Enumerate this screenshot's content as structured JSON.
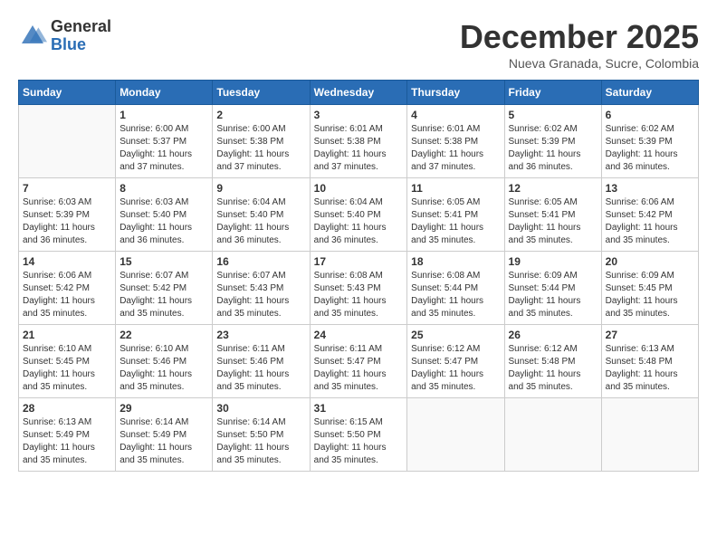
{
  "header": {
    "logo_general": "General",
    "logo_blue": "Blue",
    "month_title": "December 2025",
    "location": "Nueva Granada, Sucre, Colombia"
  },
  "weekdays": [
    "Sunday",
    "Monday",
    "Tuesday",
    "Wednesday",
    "Thursday",
    "Friday",
    "Saturday"
  ],
  "weeks": [
    [
      {
        "day": "",
        "sunrise": "",
        "sunset": "",
        "daylight": ""
      },
      {
        "day": "1",
        "sunrise": "Sunrise: 6:00 AM",
        "sunset": "Sunset: 5:37 PM",
        "daylight": "Daylight: 11 hours and 37 minutes."
      },
      {
        "day": "2",
        "sunrise": "Sunrise: 6:00 AM",
        "sunset": "Sunset: 5:38 PM",
        "daylight": "Daylight: 11 hours and 37 minutes."
      },
      {
        "day": "3",
        "sunrise": "Sunrise: 6:01 AM",
        "sunset": "Sunset: 5:38 PM",
        "daylight": "Daylight: 11 hours and 37 minutes."
      },
      {
        "day": "4",
        "sunrise": "Sunrise: 6:01 AM",
        "sunset": "Sunset: 5:38 PM",
        "daylight": "Daylight: 11 hours and 37 minutes."
      },
      {
        "day": "5",
        "sunrise": "Sunrise: 6:02 AM",
        "sunset": "Sunset: 5:39 PM",
        "daylight": "Daylight: 11 hours and 36 minutes."
      },
      {
        "day": "6",
        "sunrise": "Sunrise: 6:02 AM",
        "sunset": "Sunset: 5:39 PM",
        "daylight": "Daylight: 11 hours and 36 minutes."
      }
    ],
    [
      {
        "day": "7",
        "sunrise": "Sunrise: 6:03 AM",
        "sunset": "Sunset: 5:39 PM",
        "daylight": "Daylight: 11 hours and 36 minutes."
      },
      {
        "day": "8",
        "sunrise": "Sunrise: 6:03 AM",
        "sunset": "Sunset: 5:40 PM",
        "daylight": "Daylight: 11 hours and 36 minutes."
      },
      {
        "day": "9",
        "sunrise": "Sunrise: 6:04 AM",
        "sunset": "Sunset: 5:40 PM",
        "daylight": "Daylight: 11 hours and 36 minutes."
      },
      {
        "day": "10",
        "sunrise": "Sunrise: 6:04 AM",
        "sunset": "Sunset: 5:40 PM",
        "daylight": "Daylight: 11 hours and 36 minutes."
      },
      {
        "day": "11",
        "sunrise": "Sunrise: 6:05 AM",
        "sunset": "Sunset: 5:41 PM",
        "daylight": "Daylight: 11 hours and 35 minutes."
      },
      {
        "day": "12",
        "sunrise": "Sunrise: 6:05 AM",
        "sunset": "Sunset: 5:41 PM",
        "daylight": "Daylight: 11 hours and 35 minutes."
      },
      {
        "day": "13",
        "sunrise": "Sunrise: 6:06 AM",
        "sunset": "Sunset: 5:42 PM",
        "daylight": "Daylight: 11 hours and 35 minutes."
      }
    ],
    [
      {
        "day": "14",
        "sunrise": "Sunrise: 6:06 AM",
        "sunset": "Sunset: 5:42 PM",
        "daylight": "Daylight: 11 hours and 35 minutes."
      },
      {
        "day": "15",
        "sunrise": "Sunrise: 6:07 AM",
        "sunset": "Sunset: 5:42 PM",
        "daylight": "Daylight: 11 hours and 35 minutes."
      },
      {
        "day": "16",
        "sunrise": "Sunrise: 6:07 AM",
        "sunset": "Sunset: 5:43 PM",
        "daylight": "Daylight: 11 hours and 35 minutes."
      },
      {
        "day": "17",
        "sunrise": "Sunrise: 6:08 AM",
        "sunset": "Sunset: 5:43 PM",
        "daylight": "Daylight: 11 hours and 35 minutes."
      },
      {
        "day": "18",
        "sunrise": "Sunrise: 6:08 AM",
        "sunset": "Sunset: 5:44 PM",
        "daylight": "Daylight: 11 hours and 35 minutes."
      },
      {
        "day": "19",
        "sunrise": "Sunrise: 6:09 AM",
        "sunset": "Sunset: 5:44 PM",
        "daylight": "Daylight: 11 hours and 35 minutes."
      },
      {
        "day": "20",
        "sunrise": "Sunrise: 6:09 AM",
        "sunset": "Sunset: 5:45 PM",
        "daylight": "Daylight: 11 hours and 35 minutes."
      }
    ],
    [
      {
        "day": "21",
        "sunrise": "Sunrise: 6:10 AM",
        "sunset": "Sunset: 5:45 PM",
        "daylight": "Daylight: 11 hours and 35 minutes."
      },
      {
        "day": "22",
        "sunrise": "Sunrise: 6:10 AM",
        "sunset": "Sunset: 5:46 PM",
        "daylight": "Daylight: 11 hours and 35 minutes."
      },
      {
        "day": "23",
        "sunrise": "Sunrise: 6:11 AM",
        "sunset": "Sunset: 5:46 PM",
        "daylight": "Daylight: 11 hours and 35 minutes."
      },
      {
        "day": "24",
        "sunrise": "Sunrise: 6:11 AM",
        "sunset": "Sunset: 5:47 PM",
        "daylight": "Daylight: 11 hours and 35 minutes."
      },
      {
        "day": "25",
        "sunrise": "Sunrise: 6:12 AM",
        "sunset": "Sunset: 5:47 PM",
        "daylight": "Daylight: 11 hours and 35 minutes."
      },
      {
        "day": "26",
        "sunrise": "Sunrise: 6:12 AM",
        "sunset": "Sunset: 5:48 PM",
        "daylight": "Daylight: 11 hours and 35 minutes."
      },
      {
        "day": "27",
        "sunrise": "Sunrise: 6:13 AM",
        "sunset": "Sunset: 5:48 PM",
        "daylight": "Daylight: 11 hours and 35 minutes."
      }
    ],
    [
      {
        "day": "28",
        "sunrise": "Sunrise: 6:13 AM",
        "sunset": "Sunset: 5:49 PM",
        "daylight": "Daylight: 11 hours and 35 minutes."
      },
      {
        "day": "29",
        "sunrise": "Sunrise: 6:14 AM",
        "sunset": "Sunset: 5:49 PM",
        "daylight": "Daylight: 11 hours and 35 minutes."
      },
      {
        "day": "30",
        "sunrise": "Sunrise: 6:14 AM",
        "sunset": "Sunset: 5:50 PM",
        "daylight": "Daylight: 11 hours and 35 minutes."
      },
      {
        "day": "31",
        "sunrise": "Sunrise: 6:15 AM",
        "sunset": "Sunset: 5:50 PM",
        "daylight": "Daylight: 11 hours and 35 minutes."
      },
      {
        "day": "",
        "sunrise": "",
        "sunset": "",
        "daylight": ""
      },
      {
        "day": "",
        "sunrise": "",
        "sunset": "",
        "daylight": ""
      },
      {
        "day": "",
        "sunrise": "",
        "sunset": "",
        "daylight": ""
      }
    ]
  ]
}
